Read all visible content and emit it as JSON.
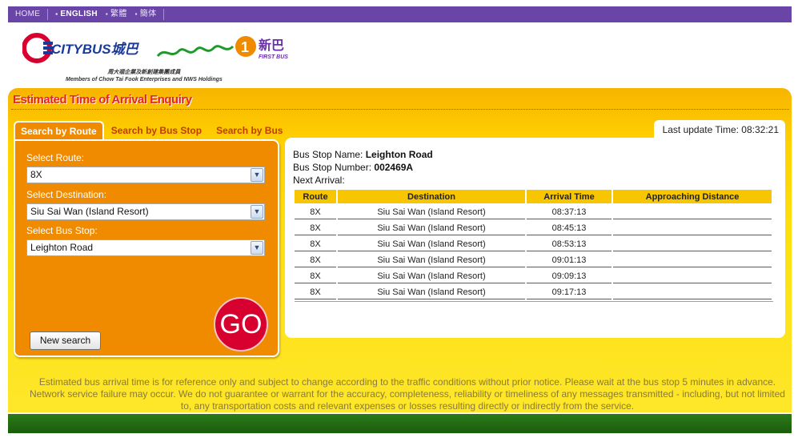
{
  "nav": {
    "home": "HOME",
    "english": "ENGLISH",
    "traditional": "繁體",
    "simplified": "簡体"
  },
  "header": {
    "citybus_logo_text": "CITYBUS城巴",
    "firstbus_logo_text": "新巴",
    "firstbus_sub": "FIRST BUS",
    "members_cn": "周大福企業及新創建集團成員",
    "members_en": "Members of Chow Tai Fook Enterprises and NWS Holdings"
  },
  "page": {
    "title": "Estimated Time of Arrival Enquiry"
  },
  "tabs": [
    {
      "label": "Search by Route",
      "active": true
    },
    {
      "label": "Search by Bus Stop",
      "active": false
    },
    {
      "label": "Search by Bus",
      "active": false
    }
  ],
  "form": {
    "route_label": "Select Route:",
    "route_value": "8X",
    "destination_label": "Select Destination:",
    "destination_value": "Siu Sai Wan (Island Resort)",
    "stop_label": "Select Bus Stop:",
    "stop_value": "Leighton Road",
    "go_label": "GO",
    "new_search_label": "New search"
  },
  "result": {
    "last_update": "Last update Time: 08:32:21",
    "stop_name_label": "Bus Stop Name:",
    "stop_name": "Leighton Road",
    "stop_number_label": "Bus Stop Number:",
    "stop_number": "002469A",
    "next_arrival_label": "Next Arrival:",
    "columns": [
      "Route",
      "Destination",
      "Arrival Time",
      "Approaching Distance"
    ],
    "rows": [
      {
        "route": "8X",
        "destination": "Siu Sai Wan (Island Resort)",
        "arrival": "08:37:13",
        "distance": ""
      },
      {
        "route": "8X",
        "destination": "Siu Sai Wan (Island Resort)",
        "arrival": "08:45:13",
        "distance": ""
      },
      {
        "route": "8X",
        "destination": "Siu Sai Wan (Island Resort)",
        "arrival": "08:53:13",
        "distance": ""
      },
      {
        "route": "8X",
        "destination": "Siu Sai Wan (Island Resort)",
        "arrival": "09:01:13",
        "distance": ""
      },
      {
        "route": "8X",
        "destination": "Siu Sai Wan (Island Resort)",
        "arrival": "09:09:13",
        "distance": ""
      },
      {
        "route": "8X",
        "destination": "Siu Sai Wan (Island Resort)",
        "arrival": "09:17:13",
        "distance": ""
      }
    ]
  },
  "disclaimer": "Estimated bus arrival time is for reference only and subject to change according to the traffic conditions without prior notice. Please wait at the bus stop 5 minutes in advance. Network service failure may occur. We do not guarantee or warrant for the accuracy, completeness, reliability or timeliness of any messages transmitted - including, but not limited to, any transportation costs and relevant expenses or losses resulting directly or indirectly from the service.",
  "colors": {
    "nav_purple": "#6a45a8",
    "panel_yellow": "#ffd200",
    "orange": "#f08b00",
    "title_red": "#e8222a",
    "go_red": "#d8002f",
    "footer_green": "#1a5d0c"
  }
}
